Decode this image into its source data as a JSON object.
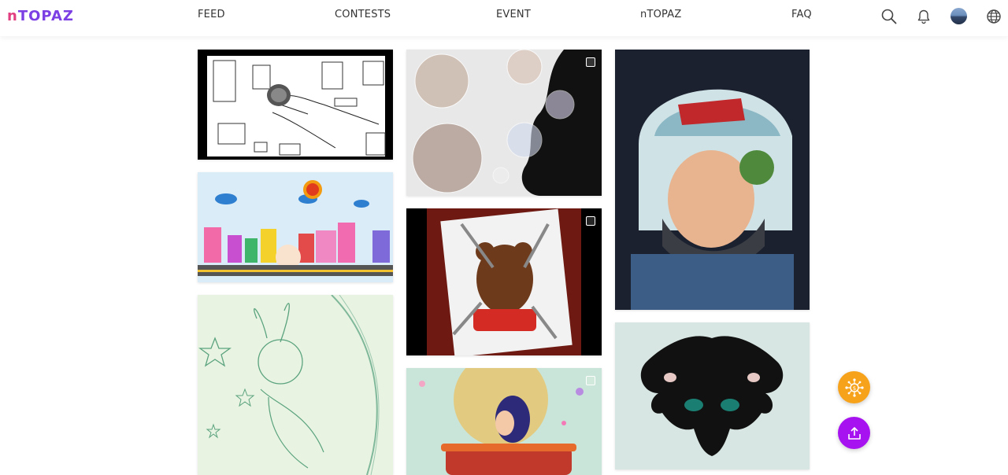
{
  "header": {
    "logo_first": "n",
    "logo_rest": "TOPAZ",
    "nav": [
      {
        "label": "FEED"
      },
      {
        "label": "CONTESTS"
      },
      {
        "label": "EVENT"
      },
      {
        "label": "nTOPAZ"
      },
      {
        "label": "FAQ"
      }
    ],
    "icons": [
      "search-icon",
      "bell-icon",
      "avatar",
      "globe-icon"
    ]
  },
  "feed": {
    "columns": 3,
    "cards": [
      {
        "subject": "line drawing of a hand holding a ball"
      },
      {
        "subject": "child silhouette blowing bubbles"
      },
      {
        "subject": "helmet boy illustration"
      },
      {
        "subject": "crayon street scene"
      },
      {
        "subject": "teddy bear with pencils"
      },
      {
        "subject": "ink blot painting"
      },
      {
        "subject": "bunny girl pencil sketch"
      },
      {
        "subject": "girl with hat colorful"
      }
    ]
  },
  "fabs": [
    {
      "icon": "coin-network-icon",
      "color": "#f7a21b"
    },
    {
      "icon": "upload-icon",
      "color": "#a713f0"
    }
  ],
  "colors": {
    "brand_purple": "#7b3fe4",
    "brand_pink": "#e13f82"
  }
}
